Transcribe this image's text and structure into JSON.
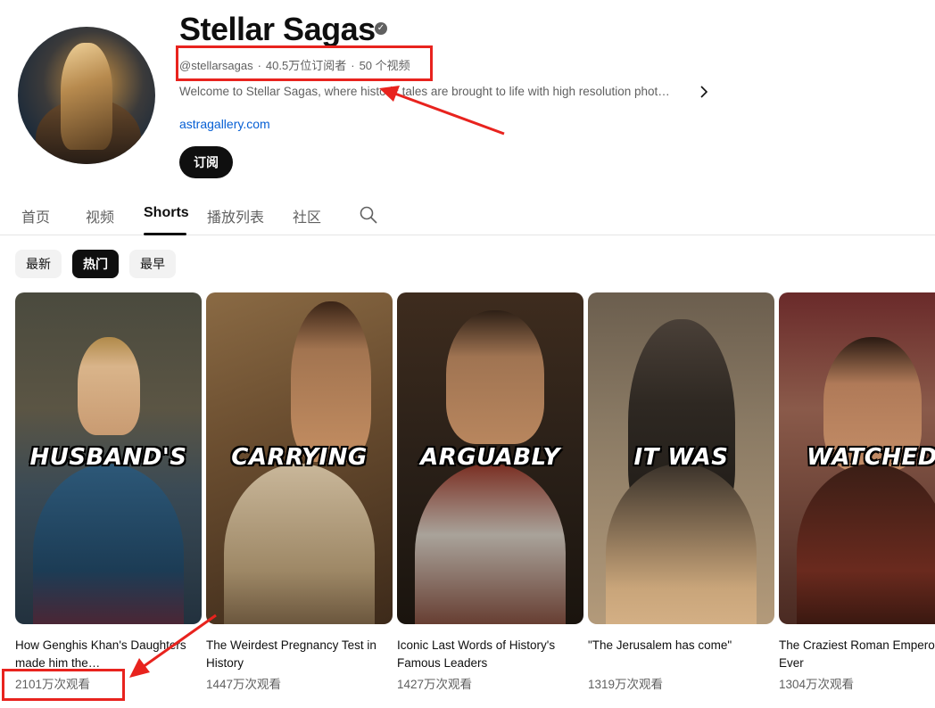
{
  "channel": {
    "title": "Stellar Sagas",
    "verified_icon": "checkmark-icon",
    "handle": "@stellarsagas",
    "subscribers": "40.5万位订阅者",
    "video_count": "50 个视频",
    "separator": "·",
    "description": "Welcome to Stellar Sagas, where historic tales are brought to life with high resolution phot…",
    "link": "astragallery.com",
    "subscribe_label": "订阅"
  },
  "tabs": [
    {
      "label": "首页",
      "active": false
    },
    {
      "label": "视频",
      "active": false
    },
    {
      "label": "Shorts",
      "active": true
    },
    {
      "label": "播放列表",
      "active": false
    },
    {
      "label": "社区",
      "active": false
    }
  ],
  "chips": [
    {
      "label": "最新",
      "active": false
    },
    {
      "label": "热门",
      "active": true
    },
    {
      "label": "最早",
      "active": false
    }
  ],
  "shorts": [
    {
      "overlay": "HUSBAND'S",
      "title": "How Genghis Khan's Daughters made him the…",
      "views": "2101万次观看"
    },
    {
      "overlay": "CARRYING",
      "title": "The Weirdest Pregnancy Test in History",
      "views": "1447万次观看"
    },
    {
      "overlay": "ARGUABLY",
      "title": "Iconic Last Words of History's Famous Leaders",
      "views": "1427万次观看"
    },
    {
      "overlay": "IT WAS",
      "title": "\"The Jerusalem has come\"",
      "views": "1319万次观看"
    },
    {
      "overlay": "WATCHED",
      "title": "The Craziest Roman Emperor Ever",
      "views": "1304万次观看"
    }
  ],
  "colors": {
    "annotation": "#e8231e",
    "link": "#065fd4",
    "text_secondary": "#606060"
  }
}
